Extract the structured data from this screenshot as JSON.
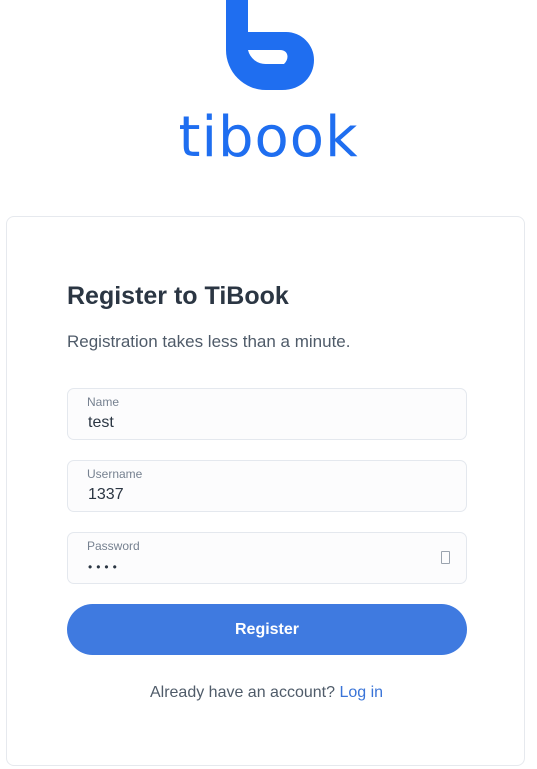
{
  "brand": {
    "wordmark": "tibook",
    "color": "#1f6ef0"
  },
  "form": {
    "title": "Register to TiBook",
    "subtitle": "Registration takes less than a minute.",
    "fields": {
      "name": {
        "label": "Name",
        "value": "test"
      },
      "username": {
        "label": "Username",
        "value": "1337"
      },
      "password": {
        "label": "Password",
        "value": "••••",
        "toggle_icon": "eye-toggle-icon"
      }
    },
    "submit_label": "Register",
    "submit_color": "#3f7ae0",
    "footer_text": "Already have an account?",
    "footer_link": "Log in"
  }
}
